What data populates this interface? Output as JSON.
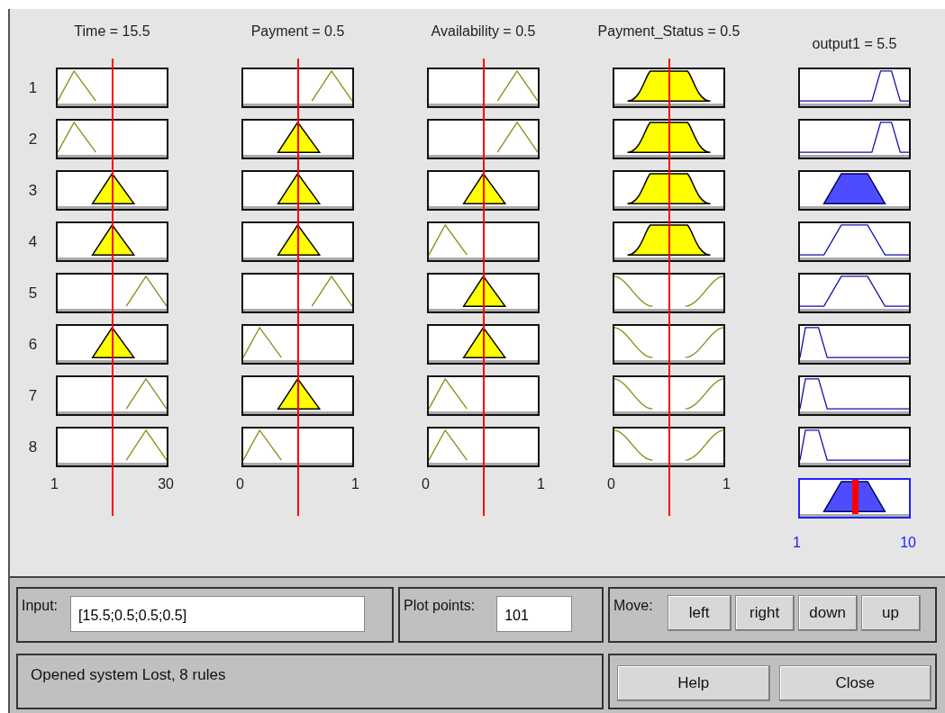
{
  "rule_numbers": [
    "1",
    "2",
    "3",
    "4",
    "5",
    "6",
    "7",
    "8"
  ],
  "inputs": [
    {
      "title": "Time = 15.5",
      "level": 0.5,
      "axis": [
        "1",
        "30"
      ],
      "rules": [
        {
          "kind": "low",
          "fired": false
        },
        {
          "kind": "low",
          "fired": false
        },
        {
          "kind": "mid",
          "fired": true
        },
        {
          "kind": "mid",
          "fired": true
        },
        {
          "kind": "high",
          "fired": false
        },
        {
          "kind": "mid",
          "fired": true
        },
        {
          "kind": "high",
          "fired": false
        },
        {
          "kind": "high",
          "fired": false
        }
      ]
    },
    {
      "title": "Payment = 0.5",
      "level": 0.5,
      "axis": [
        "0",
        "1"
      ],
      "rules": [
        {
          "kind": "high",
          "fired": false
        },
        {
          "kind": "mid",
          "fired": true
        },
        {
          "kind": "mid",
          "fired": true
        },
        {
          "kind": "mid",
          "fired": true
        },
        {
          "kind": "high",
          "fired": false
        },
        {
          "kind": "low",
          "fired": false
        },
        {
          "kind": "mid",
          "fired": true
        },
        {
          "kind": "low",
          "fired": false
        }
      ]
    },
    {
      "title": "Availability = 0.5",
      "level": 0.5,
      "axis": [
        "0",
        "1"
      ],
      "rules": [
        {
          "kind": "high",
          "fired": false
        },
        {
          "kind": "high",
          "fired": false
        },
        {
          "kind": "mid",
          "fired": true
        },
        {
          "kind": "low",
          "fired": false
        },
        {
          "kind": "mid",
          "fired": true
        },
        {
          "kind": "mid",
          "fired": true
        },
        {
          "kind": "low",
          "fired": false
        },
        {
          "kind": "low",
          "fired": false
        }
      ]
    },
    {
      "title": "Payment_Status = 0.5",
      "level": 0.5,
      "axis": [
        "0",
        "1"
      ],
      "rules": [
        {
          "kind": "trap",
          "fired": true
        },
        {
          "kind": "trap",
          "fired": true
        },
        {
          "kind": "trap",
          "fired": true
        },
        {
          "kind": "trap",
          "fired": true
        },
        {
          "kind": "notch",
          "fired": false
        },
        {
          "kind": "notch",
          "fired": false
        },
        {
          "kind": "notch",
          "fired": false
        },
        {
          "kind": "notch",
          "fired": false
        }
      ]
    }
  ],
  "output": {
    "title": "output1 = 5.5",
    "level": 0.5,
    "axis": [
      "1",
      "10"
    ],
    "rules": [
      {
        "kind": "high",
        "fired": false
      },
      {
        "kind": "high",
        "fired": false
      },
      {
        "kind": "mid",
        "fired": true
      },
      {
        "kind": "mid",
        "fired": false
      },
      {
        "kind": "mid",
        "fired": false
      },
      {
        "kind": "low",
        "fired": false
      },
      {
        "kind": "low",
        "fired": false
      },
      {
        "kind": "low",
        "fired": false
      }
    ],
    "aggregate": {
      "kind": "mid"
    }
  },
  "input_field": {
    "label": "Input:",
    "value": "[15.5;0.5;0.5;0.5]"
  },
  "plot_points": {
    "label": "Plot points:",
    "value": "101"
  },
  "move": {
    "label": "Move:",
    "buttons": [
      "left",
      "right",
      "down",
      "up"
    ]
  },
  "status": "Opened system Lost, 8 rules",
  "buttons": [
    "Help",
    "Close"
  ]
}
